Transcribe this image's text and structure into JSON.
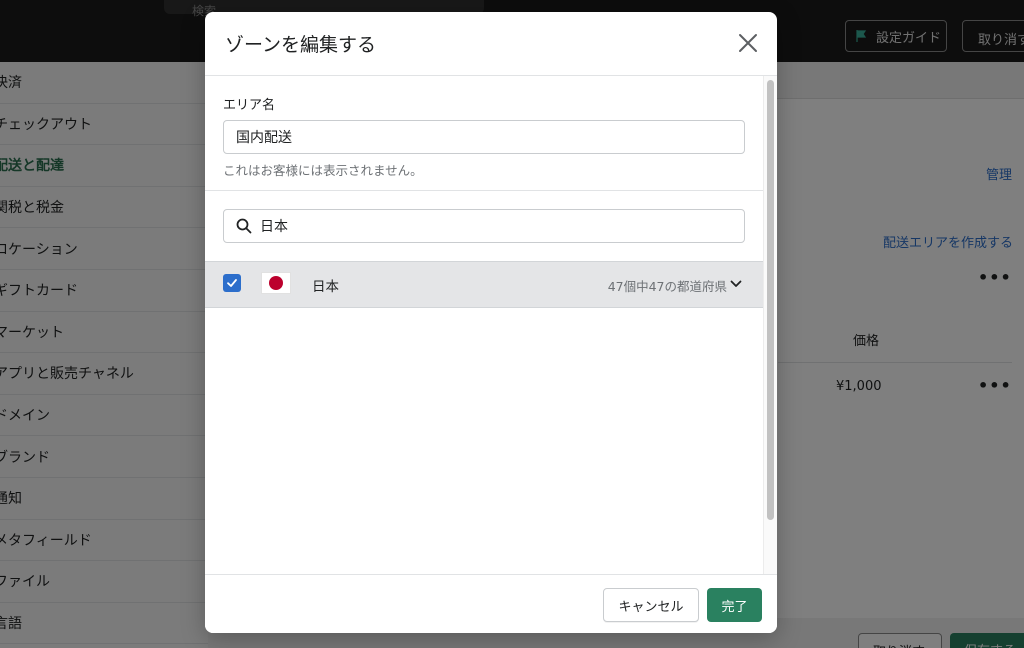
{
  "topbar": {
    "search_placeholder": "検索",
    "guide_label": "設定ガイド",
    "cancel_label": "取り消す"
  },
  "sidebar": {
    "items": [
      {
        "label": "決済"
      },
      {
        "label": "チェックアウト"
      },
      {
        "label": "配送と配達",
        "active": true
      },
      {
        "label": "関税と税金"
      },
      {
        "label": "ロケーション"
      },
      {
        "label": "ギフトカード"
      },
      {
        "label": "マーケット"
      },
      {
        "label": "アプリと販売チャネル"
      },
      {
        "label": "ドメイン"
      },
      {
        "label": "ブランド"
      },
      {
        "label": "通知"
      },
      {
        "label": "メタフィールド"
      },
      {
        "label": "ファイル"
      },
      {
        "label": "言語"
      }
    ]
  },
  "background": {
    "manage_link": "管理",
    "create_area_link": "配送エリアを作成する",
    "price_header": "価格",
    "price_value": "¥1,000",
    "more": "•••",
    "footer_cancel": "取り消す",
    "footer_save": "保存する"
  },
  "modal": {
    "title": "ゾーンを編集する",
    "area_label": "エリア名",
    "area_value": "国内配送",
    "area_help": "これはお客様には表示されません。",
    "search_value": "日本",
    "country": {
      "name": "日本",
      "count": "47個中47の都道府県",
      "checked": true
    },
    "cancel_label": "キャンセル",
    "done_label": "完了"
  },
  "colors": {
    "primary": "#2a8160",
    "checkbox": "#2c6ecb",
    "link": "#2c6ecb",
    "flag_red": "#bc002d"
  }
}
